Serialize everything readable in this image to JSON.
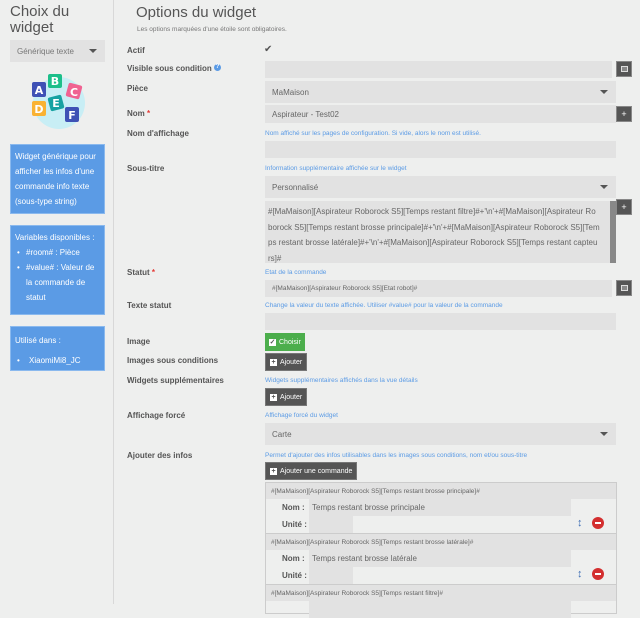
{
  "sidebar": {
    "title": "Choix du widget",
    "widget_type": "Générique texte",
    "logo_letters": "ABCDEF",
    "description": "Widget générique pour afficher les infos d'une commande info texte (sous-type string)",
    "variables_title": "Variables disponibles :",
    "variables": [
      "#room# : Pièce",
      "#value# : Valeur de la commande de statut"
    ],
    "used_title": "Utilisé dans :",
    "used_in": [
      "XiaomiMi8_JC"
    ]
  },
  "main": {
    "title": "Options du widget",
    "subtitle": "Les options marquées d'une étoile sont obligatoires.",
    "fields": {
      "actif": "Actif",
      "visible": "Visible sous condition",
      "piece": "Pièce",
      "piece_value": "MaMaison",
      "nom": "Nom",
      "nom_value": "Aspirateur - Test02",
      "nom_affichage": "Nom d'affichage",
      "nom_affichage_help": "Nom affiché sur les pages de configuration. Si vide, alors le nom est utilisé.",
      "sous_titre": "Sous-titre",
      "sous_titre_help": "Information supplémentaire affichée sur le widget",
      "sous_titre_select": "Personnalisé",
      "sous_titre_value": "#[MaMaison][Aspirateur Roborock S5][Temps restant filtre]#+'\\n'+#[MaMaison][Aspirateur Roborock S5][Temps restant brosse principale]#+'\\n'+#[MaMaison][Aspirateur Roborock S5][Temps restant brosse latérale]#+'\\n'+#[MaMaison][Aspirateur Roborock S5][Temps restant capteurs]#",
      "statut": "Statut",
      "statut_help": "Etat de la commande",
      "statut_value": "#[MaMaison][Aspirateur Roborock S5][Etat robot]#",
      "texte_statut": "Texte statut",
      "texte_statut_help": "Change la valeur du texte affichée. Utiliser #value# pour la valeur de la commande",
      "image": "Image",
      "choisir": "Choisir",
      "images_cond": "Images sous conditions",
      "ajouter": "Ajouter",
      "widgets_supp": "Widgets supplémentaires",
      "widgets_supp_help": "Widgets supplémentaires affichés dans la vue détails",
      "affichage_force": "Affichage forcé",
      "affichage_force_help": "Affichage forcé du widget",
      "affichage_force_value": "Carte",
      "ajouter_infos": "Ajouter des infos",
      "ajouter_infos_help": "Permet d'ajouter des infos utilisables dans les images sous conditions, nom et/ou sous-titre",
      "ajouter_commande": "Ajouter une commande"
    },
    "infos_labels": {
      "nom": "Nom :",
      "unite": "Unité :"
    },
    "infos": [
      {
        "cmd": "#[MaMaison][Aspirateur Roborock S5][Temps restant brosse principale]#",
        "nom": "Temps restant brosse principale",
        "unite": ""
      },
      {
        "cmd": "#[MaMaison][Aspirateur Roborock S5][Temps restant brosse latérale]#",
        "nom": "Temps restant brosse latérale",
        "unite": ""
      },
      {
        "cmd": "#[MaMaison][Aspirateur Roborock S5][Temps restant filtre]#",
        "nom": "",
        "unite": ""
      }
    ]
  },
  "colors": {
    "accent": "#5b9be5",
    "button_dark": "#555555",
    "button_green": "#4cae4c",
    "danger": "#d32f2f"
  }
}
